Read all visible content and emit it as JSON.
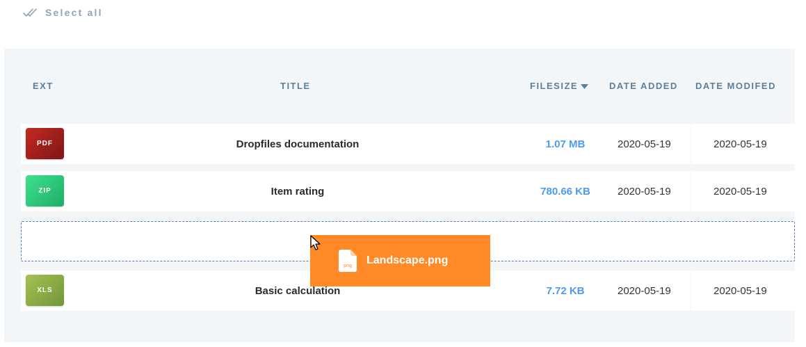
{
  "toolbar": {
    "select_all_label": "Select all",
    "icon": "double-check-icon"
  },
  "table": {
    "columns": {
      "ext": "EXT",
      "title": "TITLE",
      "filesize": "FILESIZE",
      "date_added": "DATE ADDED",
      "date_modified": "DATE MODIFED"
    },
    "sort": {
      "column": "filesize",
      "direction": "descending",
      "icon": "sort-down-icon"
    },
    "rows": [
      {
        "ext": "PDF",
        "title": "Dropfiles documentation",
        "filesize": "1.07 MB",
        "date_added": "2020-05-19",
        "date_modified": "2020-05-19",
        "badge_color": "#a61b1b"
      },
      {
        "ext": "ZIP",
        "title": "Item rating",
        "filesize": "780.66 KB",
        "date_added": "2020-05-19",
        "date_modified": "2020-05-19",
        "badge_color": "#2bcf7d"
      },
      {
        "ext": "XLS",
        "title": "Basic calculation",
        "filesize": "7.72 KB",
        "date_added": "2020-05-19",
        "date_modified": "2020-05-19",
        "badge_color": "#8fae3f"
      }
    ]
  },
  "drag": {
    "file_name": "Landscape.png",
    "icon_text": "png",
    "icon": "png-file-icon",
    "background": "#ff8a27"
  },
  "cursor": {
    "icon": "mouse-pointer-icon"
  }
}
